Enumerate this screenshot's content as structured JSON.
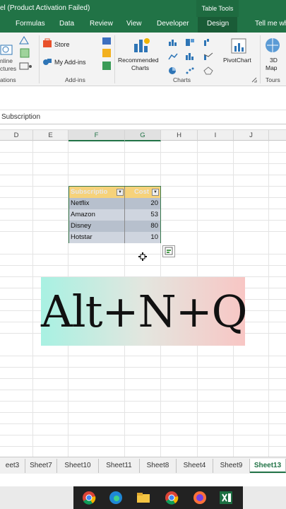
{
  "title": "el (Product Activation Failed)",
  "table_tools": "Table Tools",
  "tabs": [
    "Formulas",
    "Data",
    "Review",
    "View",
    "Developer",
    "Design"
  ],
  "tell_me": "Tell me wh",
  "ribbon": {
    "online": "nline",
    "pictures": "ctures",
    "store": "Store",
    "my_addins": "My Add-ins",
    "recommended": "Recommended",
    "charts_btn": "Charts",
    "pivotchart": "PivotChart",
    "map3d_a": "3D",
    "map3d_b": "Map",
    "groups": {
      "illustrations": "ations",
      "addins": "Add-ins",
      "charts": "Charts",
      "tours": "Tours"
    }
  },
  "formula_bar": {
    "value": "Subscription"
  },
  "columns": [
    "D",
    "E",
    "F",
    "G",
    "H",
    "I",
    "J"
  ],
  "table": {
    "headers": [
      "Subscriptio",
      "Cost"
    ],
    "rows": [
      [
        "Netflix",
        "20"
      ],
      [
        "Amazon",
        "53"
      ],
      [
        "Disney",
        "80"
      ],
      [
        "Hotstar",
        "10"
      ]
    ]
  },
  "overlay": {
    "text": "Alt+N+Q"
  },
  "sheets": [
    "eet3",
    "Sheet7",
    "Sheet10",
    "Sheet11",
    "Sheet8",
    "Sheet4",
    "Sheet9",
    "Sheet13"
  ],
  "colors": {
    "excel_green": "#217346",
    "table_header": "#f6d27a",
    "band1": "#b7c0cd",
    "band2": "#cfd5df"
  }
}
